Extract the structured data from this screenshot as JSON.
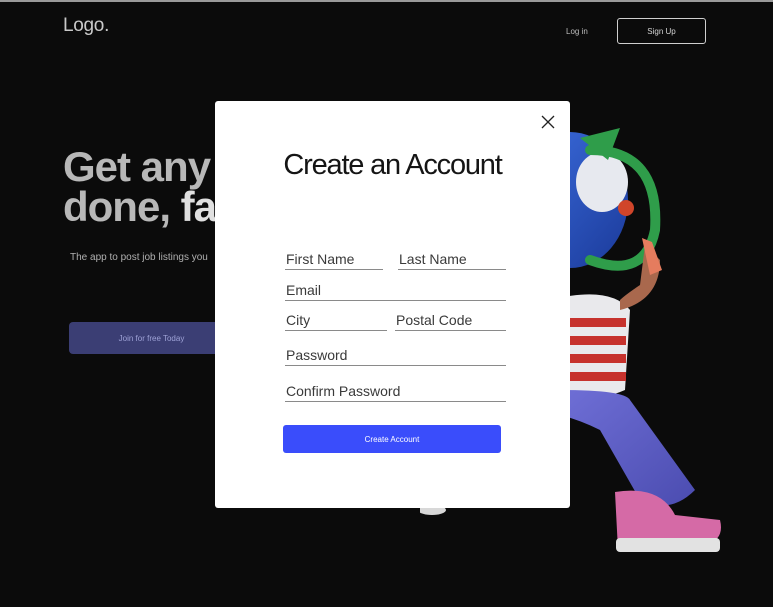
{
  "header": {
    "logo": "Logo.",
    "login_label": "Log in",
    "signup_label": "Sign Up"
  },
  "hero": {
    "line1": "Get any",
    "line2_a": "done, ",
    "line2_b": "fa",
    "subtitle": "The app to post job listings you",
    "cta_label": "Join for free Today"
  },
  "modal": {
    "title": "Create an Account",
    "fields": {
      "first_name": {
        "placeholder": "First Name",
        "value": ""
      },
      "last_name": {
        "placeholder": "Last Name",
        "value": ""
      },
      "email": {
        "placeholder": "Email",
        "value": ""
      },
      "city": {
        "placeholder": "City",
        "value": ""
      },
      "postal_code": {
        "placeholder": "Postal Code",
        "value": ""
      },
      "password": {
        "placeholder": "Password",
        "value": ""
      },
      "confirm_password": {
        "placeholder": "Confirm Password",
        "value": ""
      }
    },
    "submit_label": "Create Account"
  },
  "colors": {
    "background": "#0b0b0b",
    "primary_button": "#3a4dfb",
    "secondary_button": "#3b3e74",
    "modal_background": "#ffffff"
  },
  "icons": {
    "close": "close-icon"
  }
}
